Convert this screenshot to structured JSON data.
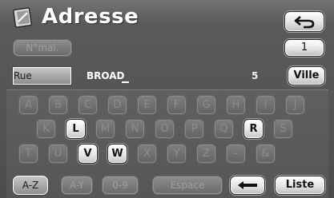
{
  "header": {
    "title": "Adresse",
    "title_icon": "address-book-icon",
    "back_icon": "back-arrow-icon",
    "number_button": "1"
  },
  "options": {
    "nmai_label": "N°mai."
  },
  "input": {
    "field_label": "Rue",
    "value": "BROAD",
    "match_count": "5",
    "city_button": "Ville"
  },
  "keyboard": {
    "keys": [
      {
        "label": "A",
        "enabled": false
      },
      {
        "label": "B",
        "enabled": false
      },
      {
        "label": "C",
        "enabled": false
      },
      {
        "label": "D",
        "enabled": false
      },
      {
        "label": "E",
        "enabled": false
      },
      {
        "label": "F",
        "enabled": false
      },
      {
        "label": "G",
        "enabled": false
      },
      {
        "label": "H",
        "enabled": false
      },
      {
        "label": "I",
        "enabled": false
      },
      {
        "label": "J",
        "enabled": false
      },
      {
        "label": "K",
        "enabled": false
      },
      {
        "label": "L",
        "enabled": true
      },
      {
        "label": "M",
        "enabled": false
      },
      {
        "label": "N",
        "enabled": false
      },
      {
        "label": "O",
        "enabled": false
      },
      {
        "label": "P",
        "enabled": false
      },
      {
        "label": "Q",
        "enabled": false
      },
      {
        "label": "R",
        "enabled": true
      },
      {
        "label": "S",
        "enabled": false
      },
      {
        "label": "T",
        "enabled": false
      },
      {
        "label": "U",
        "enabled": false
      },
      {
        "label": "V",
        "enabled": true
      },
      {
        "label": "W",
        "enabled": true
      },
      {
        "label": "X",
        "enabled": false
      },
      {
        "label": "Y",
        "enabled": false
      },
      {
        "label": "Z",
        "enabled": false
      },
      {
        "label": "-",
        "enabled": false
      },
      {
        "label": "&",
        "enabled": false
      }
    ]
  },
  "bottom_bar": {
    "az_label": "A-Z",
    "ay_label": "A-Y",
    "n09_label": "0-9",
    "space_label": "Espace",
    "delete_icon": "backspace-arrow-icon",
    "list_label": "Liste"
  },
  "colors": {
    "background": "#545454",
    "active_button": "#ffffff",
    "inactive_button": "#7a7a7a",
    "text": "#ffffff"
  }
}
